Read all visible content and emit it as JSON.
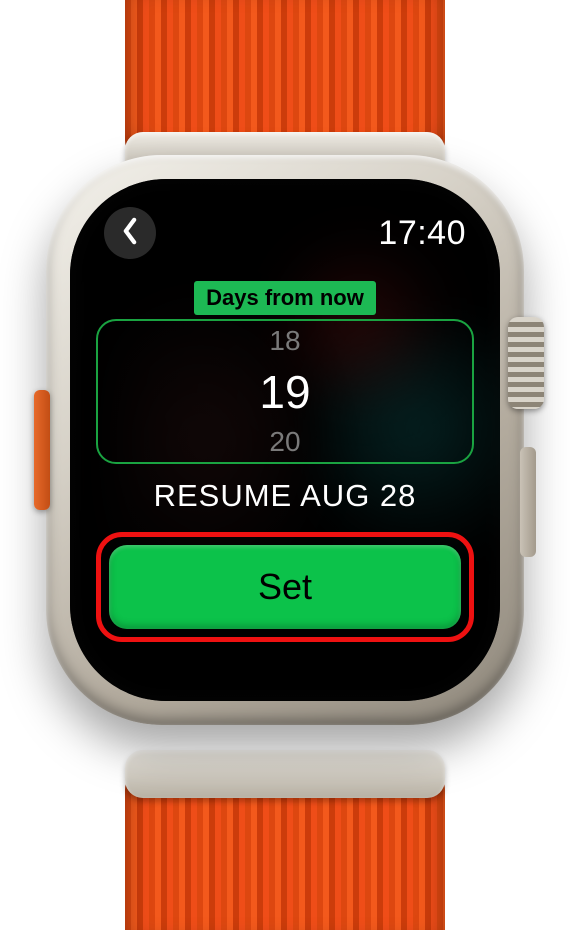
{
  "status": {
    "time": "17:40"
  },
  "picker": {
    "label": "Days from now",
    "prev": "18",
    "current": "19",
    "next": "20"
  },
  "resume_text": "RESUME AUG 28",
  "set_button_label": "Set",
  "colors": {
    "accent_green": "#0cc24a",
    "highlight_red": "#e11"
  }
}
